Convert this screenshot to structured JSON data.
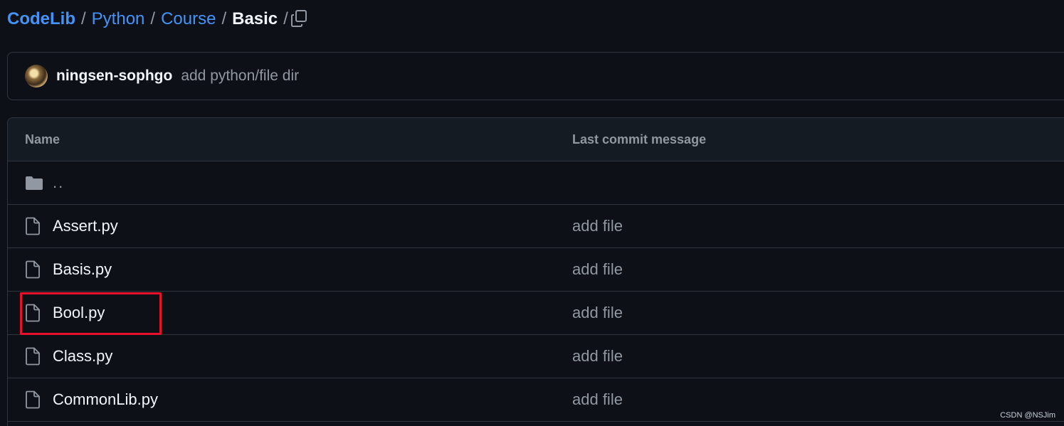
{
  "breadcrumb": {
    "items": [
      "CodeLib",
      "Python",
      "Course"
    ],
    "current": "Basic",
    "separator": "/"
  },
  "commit": {
    "author": "ningsen-sophgo",
    "message": "add python/file dir"
  },
  "table": {
    "headers": {
      "name": "Name",
      "message": "Last commit message"
    },
    "parent_label": "..",
    "rows": [
      {
        "name": "Assert.py",
        "message": "add file"
      },
      {
        "name": "Basis.py",
        "message": "add file"
      },
      {
        "name": "Bool.py",
        "message": "add file"
      },
      {
        "name": "Class.py",
        "message": "add file"
      },
      {
        "name": "CommonLib.py",
        "message": "add file"
      }
    ]
  },
  "highlighted_file": "Bool.py",
  "watermark": "CSDN @NSJim",
  "colors": {
    "link": "#4493f8",
    "background": "#0d1117",
    "highlight": "#e8102a"
  }
}
